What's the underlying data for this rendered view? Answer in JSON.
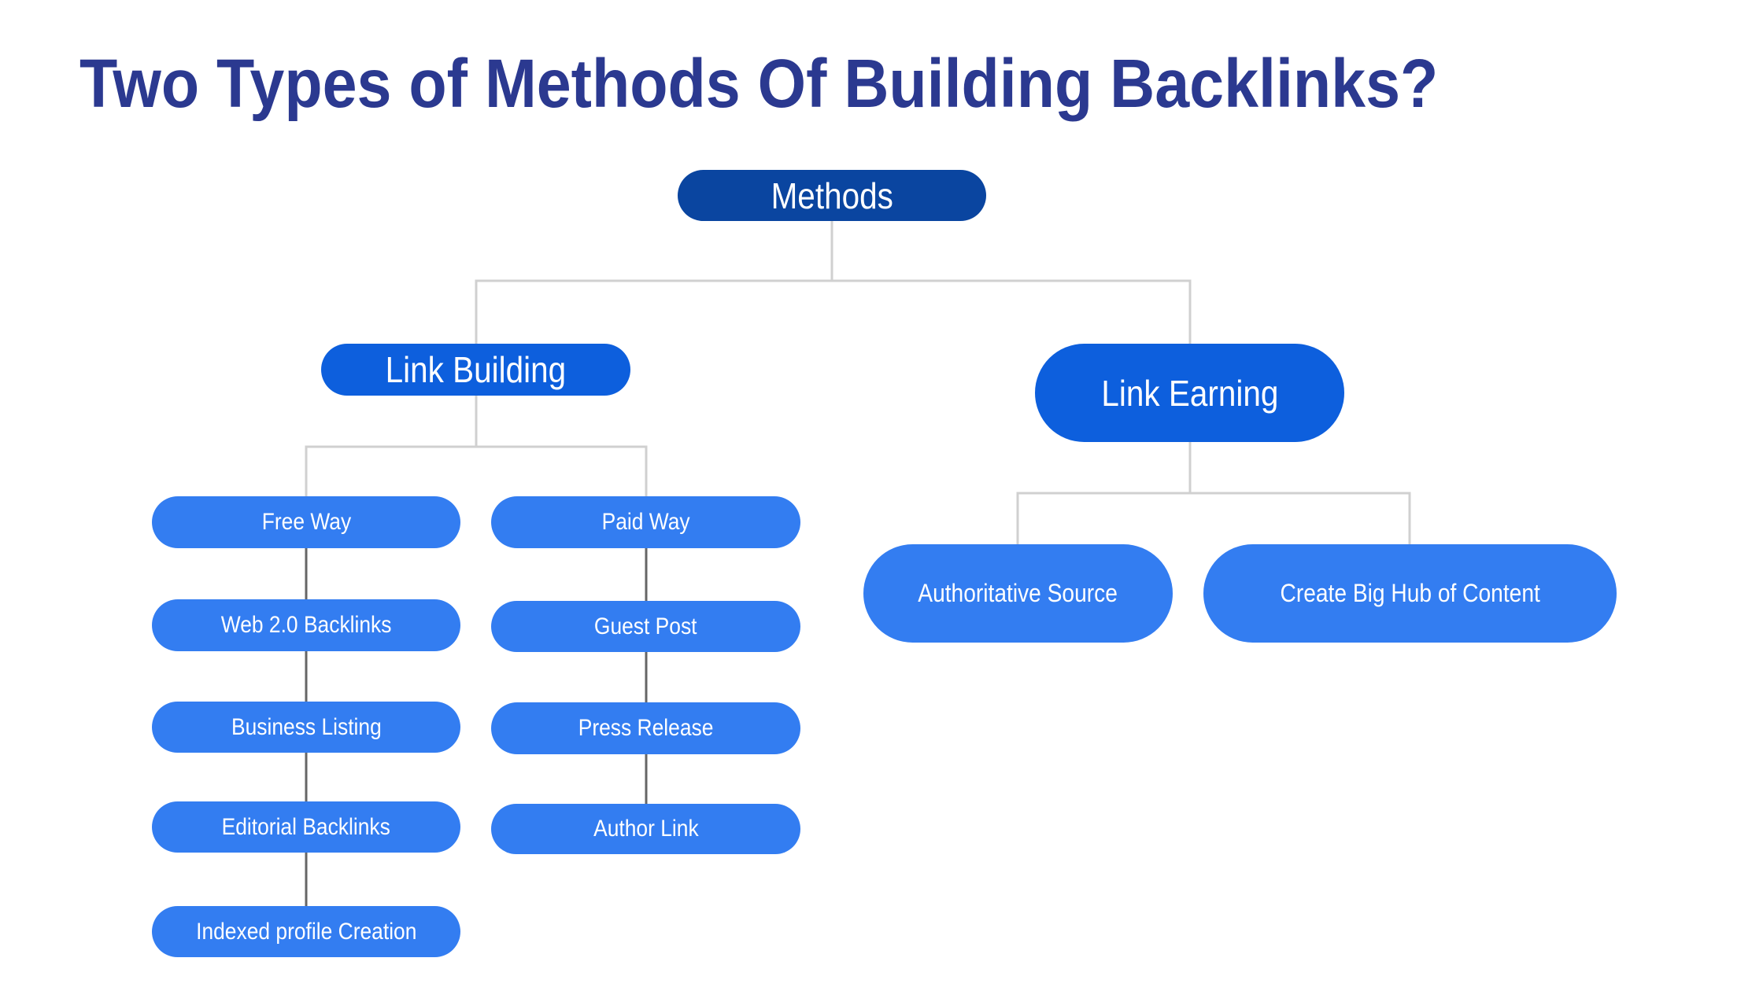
{
  "title": "Two Types of Methods Of Building Backlinks?",
  "colors": {
    "title": "#2b3990",
    "root_node": "#0a45a0",
    "branch_node": "#0d5fdd",
    "leaf_node": "#337df1",
    "connector_light": "#d0d0d0",
    "connector_dark": "#666666",
    "node_text": "#ffffff"
  },
  "diagram": {
    "root": {
      "label": "Methods"
    },
    "branches": [
      {
        "label": "Link Building",
        "groups": [
          {
            "label": "Free Way",
            "items": [
              "Web 2.0 Backlinks",
              "Business Listing",
              "Editorial Backlinks",
              "Indexed profile Creation"
            ]
          },
          {
            "label": "Paid Way",
            "items": [
              "Guest Post",
              "Press Release",
              "Author Link"
            ]
          }
        ]
      },
      {
        "label": "Link Earning",
        "children": [
          "Authoritative Source",
          "Create Big Hub of Content"
        ]
      }
    ]
  }
}
